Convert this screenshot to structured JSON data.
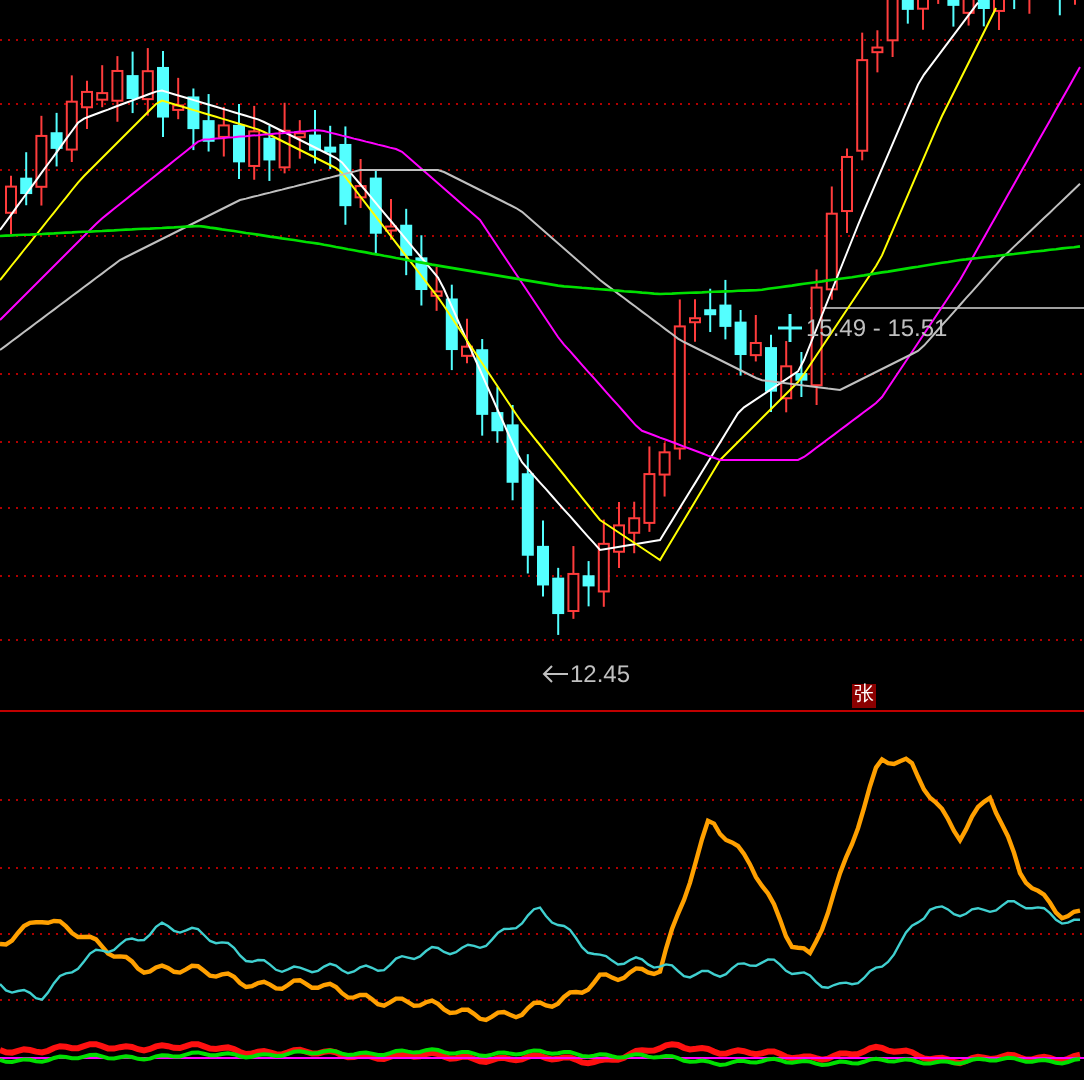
{
  "price_chart": {
    "range_label": "15.49 - 15.51",
    "low_label": "12.45"
  },
  "rise_badge": "张"
}
